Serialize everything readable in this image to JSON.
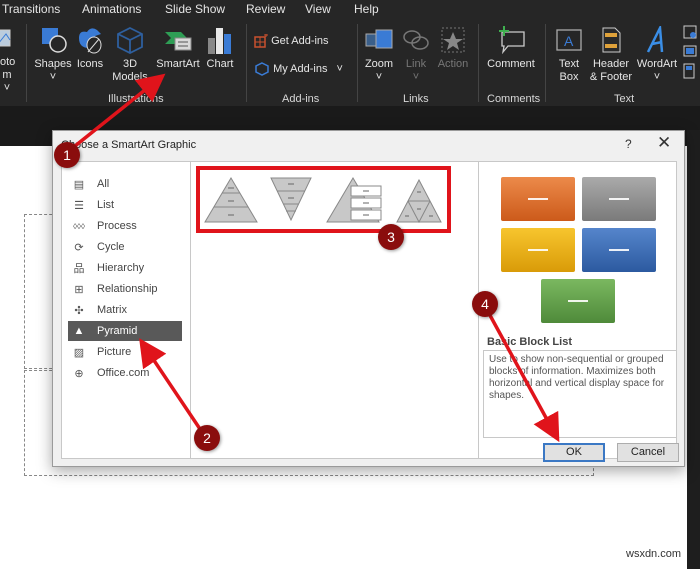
{
  "ribbon": {
    "tabs": [
      "Transitions",
      "Animations",
      "Slide Show",
      "Review",
      "View",
      "Help"
    ],
    "photo_album_partial": [
      "oto",
      "m ˅"
    ],
    "groups": {
      "illustrations": {
        "label": "Illustrations",
        "buttons": [
          {
            "label": "Shapes",
            "sub": "˅"
          },
          {
            "label": "Icons"
          },
          {
            "label": "3D",
            "sub": "Models"
          },
          {
            "label": "SmartArt"
          },
          {
            "label": "Chart"
          }
        ]
      },
      "addins": {
        "label": "Add-ins",
        "buttons": [
          {
            "label": "Get Add-ins"
          },
          {
            "label": "My Add-ins",
            "sub": "˅"
          }
        ]
      },
      "links": {
        "label": "Links",
        "buttons": [
          {
            "label": "Zoom",
            "sub": "˅"
          },
          {
            "label": "Link",
            "sub": "˅"
          },
          {
            "label": "Action"
          }
        ]
      },
      "comments": {
        "label": "Comments",
        "buttons": [
          {
            "label": "Comment"
          }
        ]
      },
      "text": {
        "label": "Text",
        "buttons": [
          {
            "label": "Text",
            "sub": "Box"
          },
          {
            "label": "Header",
            "sub": "& Footer"
          },
          {
            "label": "WordArt",
            "sub": "˅"
          }
        ]
      }
    }
  },
  "dialog": {
    "title": "Choose a SmartArt Graphic",
    "help": "?",
    "close": "✕",
    "categories": [
      {
        "label": "All",
        "icon": "all-icon"
      },
      {
        "label": "List",
        "icon": "list-icon"
      },
      {
        "label": "Process",
        "icon": "process-icon"
      },
      {
        "label": "Cycle",
        "icon": "cycle-icon"
      },
      {
        "label": "Hierarchy",
        "icon": "hierarchy-icon"
      },
      {
        "label": "Relationship",
        "icon": "relationship-icon"
      },
      {
        "label": "Matrix",
        "icon": "matrix-icon"
      },
      {
        "label": "Pyramid",
        "icon": "pyramid-icon",
        "selected": true
      },
      {
        "label": "Picture",
        "icon": "picture-icon"
      },
      {
        "label": "Office.com",
        "icon": "globe-icon"
      }
    ],
    "gallery": [
      "basic-pyramid",
      "inverted-pyramid",
      "pyramid-list",
      "segmented-pyramid"
    ],
    "preview": {
      "title": "Basic Block List",
      "description": "Use to show non-sequential or grouped blocks of information. Maximizes both horizontal and vertical display space for shapes.",
      "block_colors": [
        "#e0702a",
        "#8c8c8c",
        "#f2b90f",
        "#3d6fb8",
        "#6aa84f"
      ]
    },
    "ok_label": "OK",
    "cancel_label": "Cancel"
  },
  "annotations": {
    "color": "#e0141b",
    "badges": [
      "1",
      "2",
      "3",
      "4"
    ]
  },
  "watermark": "wsxdn.com"
}
